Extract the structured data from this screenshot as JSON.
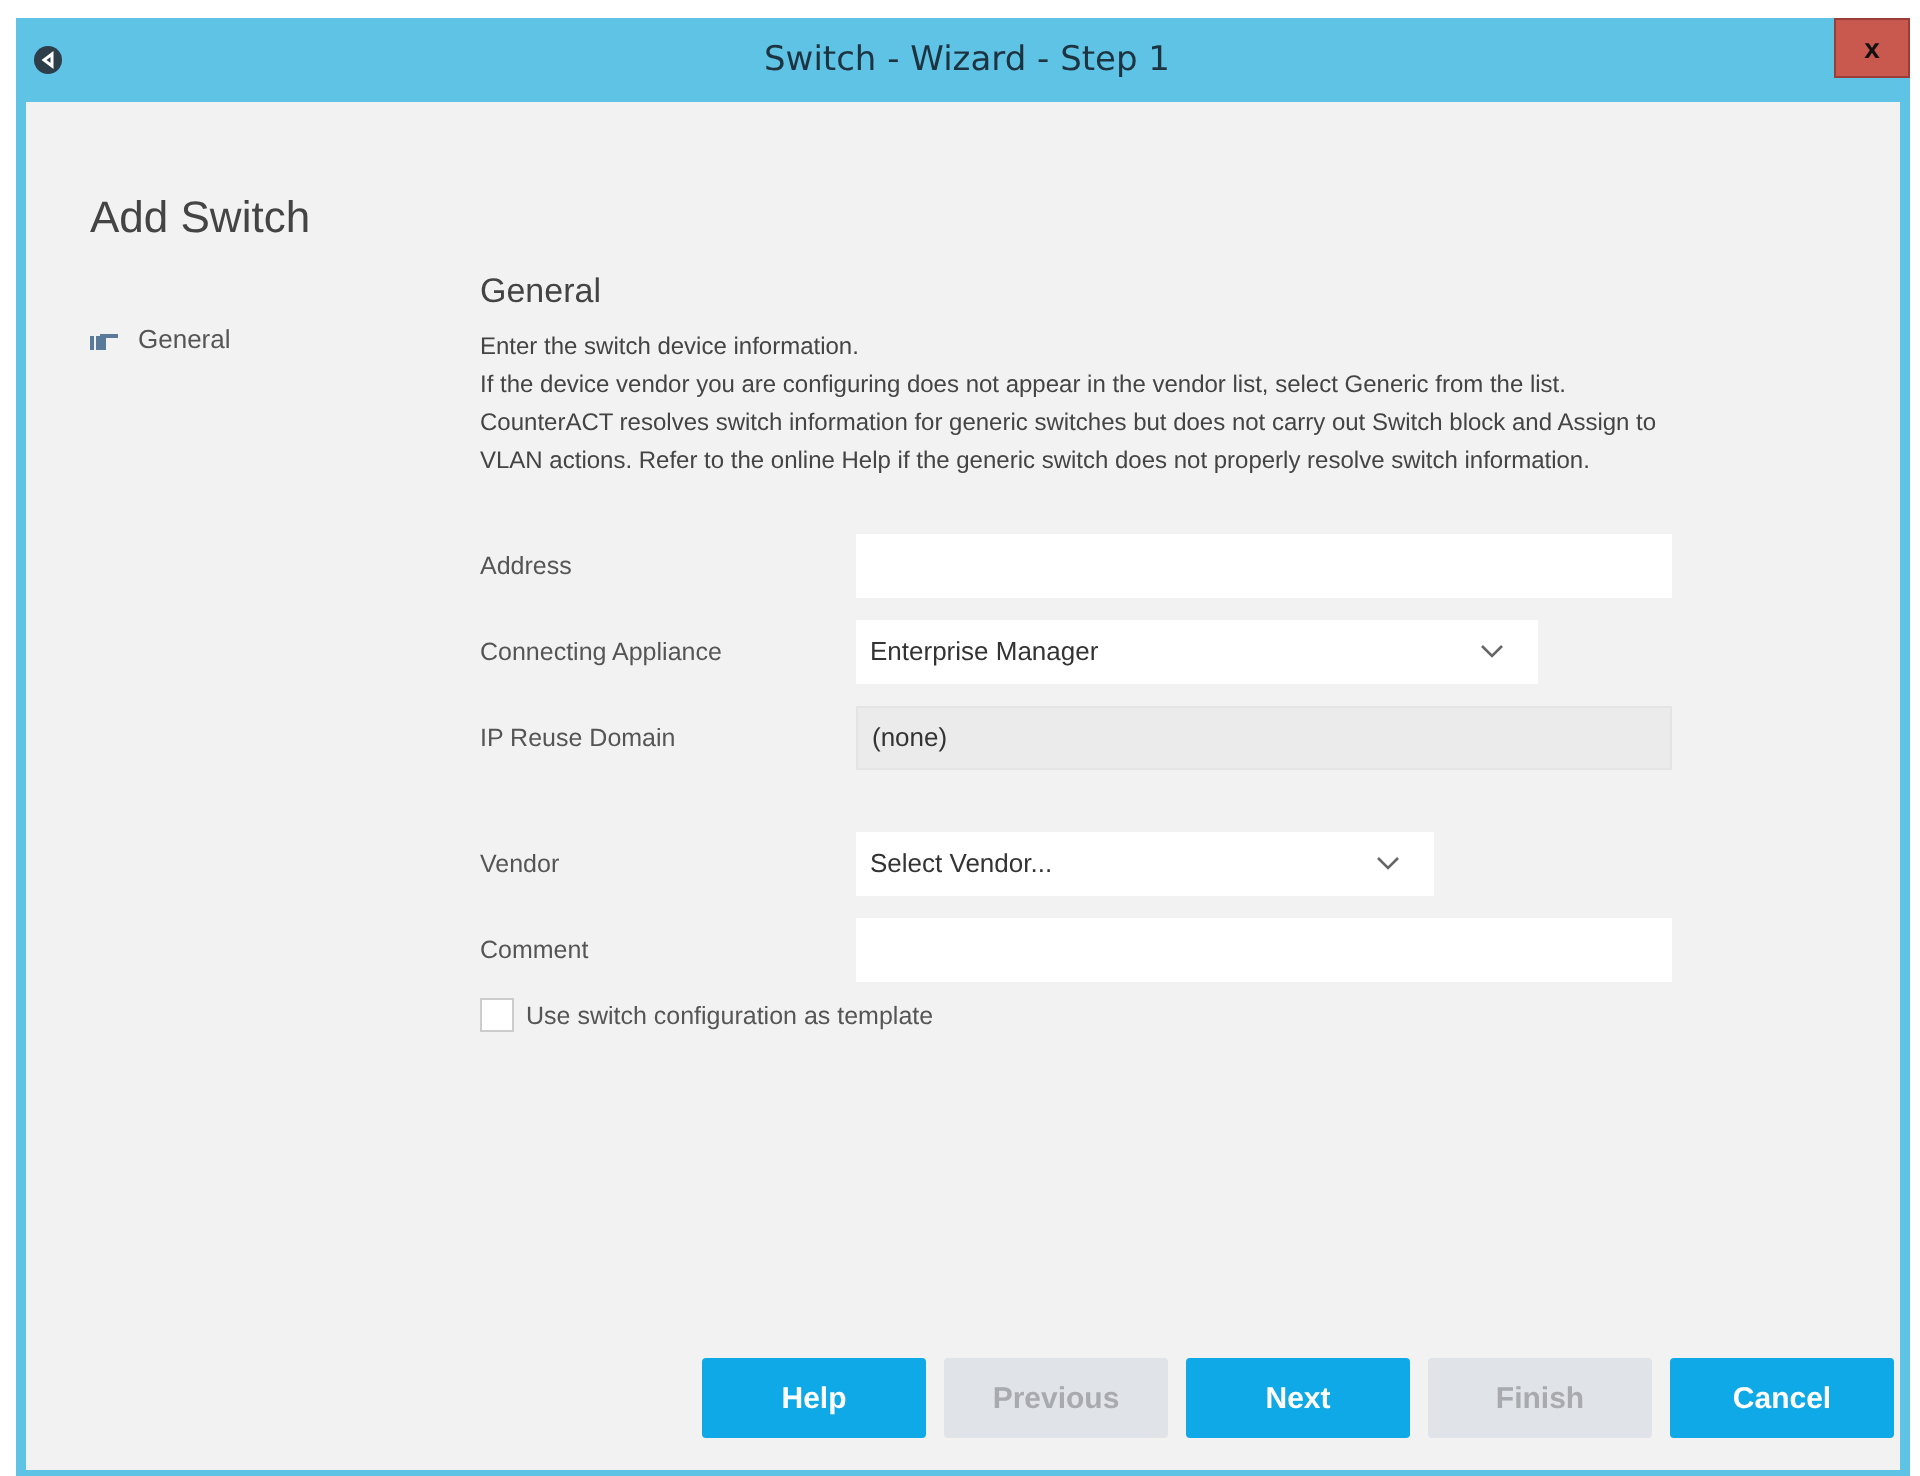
{
  "window": {
    "title": "Switch - Wizard - Step 1",
    "close": "x"
  },
  "heading": "Add Switch",
  "steps": [
    {
      "label": "General",
      "selected": true
    }
  ],
  "section": {
    "title": "General",
    "intro": "Enter the switch device information.",
    "description": "If the device vendor you are configuring does not appear in the vendor list, select Generic from the list. CounterACT resolves switch information for generic switches but does not carry out Switch block and Assign to VLAN actions. Refer to the online Help if the generic switch does not properly resolve switch information."
  },
  "fields": [
    {
      "label": "Address",
      "kind": "text"
    },
    {
      "label": "Connecting Appliance",
      "kind": "dropdown",
      "value": "Enterprise Manager"
    },
    {
      "label": "IP Reuse Domain",
      "kind": "readonly",
      "value": "(none)"
    },
    {
      "label": "Vendor",
      "kind": "dropdown",
      "value": "Select Vendor..."
    },
    {
      "label": "Comment",
      "kind": "text"
    }
  ],
  "template_checkbox": {
    "label": "Use switch configuration as template",
    "checked": false
  },
  "buttons": [
    {
      "label": "Help",
      "disabled": false
    },
    {
      "label": "Previous",
      "disabled": true
    },
    {
      "label": "Next",
      "disabled": false
    },
    {
      "label": "Finish",
      "disabled": true
    },
    {
      "label": "Cancel",
      "disabled": false
    }
  ]
}
